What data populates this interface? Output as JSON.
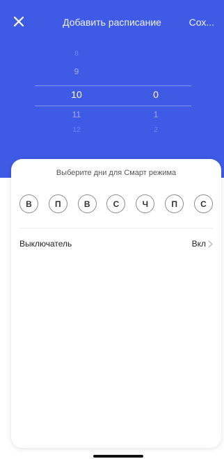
{
  "header": {
    "close_icon": "close-icon",
    "title": "Добавить расписание",
    "save_label": "Сох..."
  },
  "time_picker": {
    "hours": [
      "8",
      "9",
      "10",
      "11",
      "12"
    ],
    "minutes": [
      "0",
      "1",
      "2"
    ],
    "selected_hour": "10",
    "selected_minute": "0"
  },
  "sheet": {
    "days_title": "Выберите дни для Смарт режима",
    "days": [
      "В",
      "П",
      "В",
      "С",
      "Ч",
      "П",
      "С"
    ],
    "switch_row": {
      "label": "Выключатель",
      "value": "Вкл",
      "chevron_icon": "chevron-right-icon"
    }
  },
  "colors": {
    "accent": "#3f5be6",
    "sheet_bg": "#ffffff"
  }
}
